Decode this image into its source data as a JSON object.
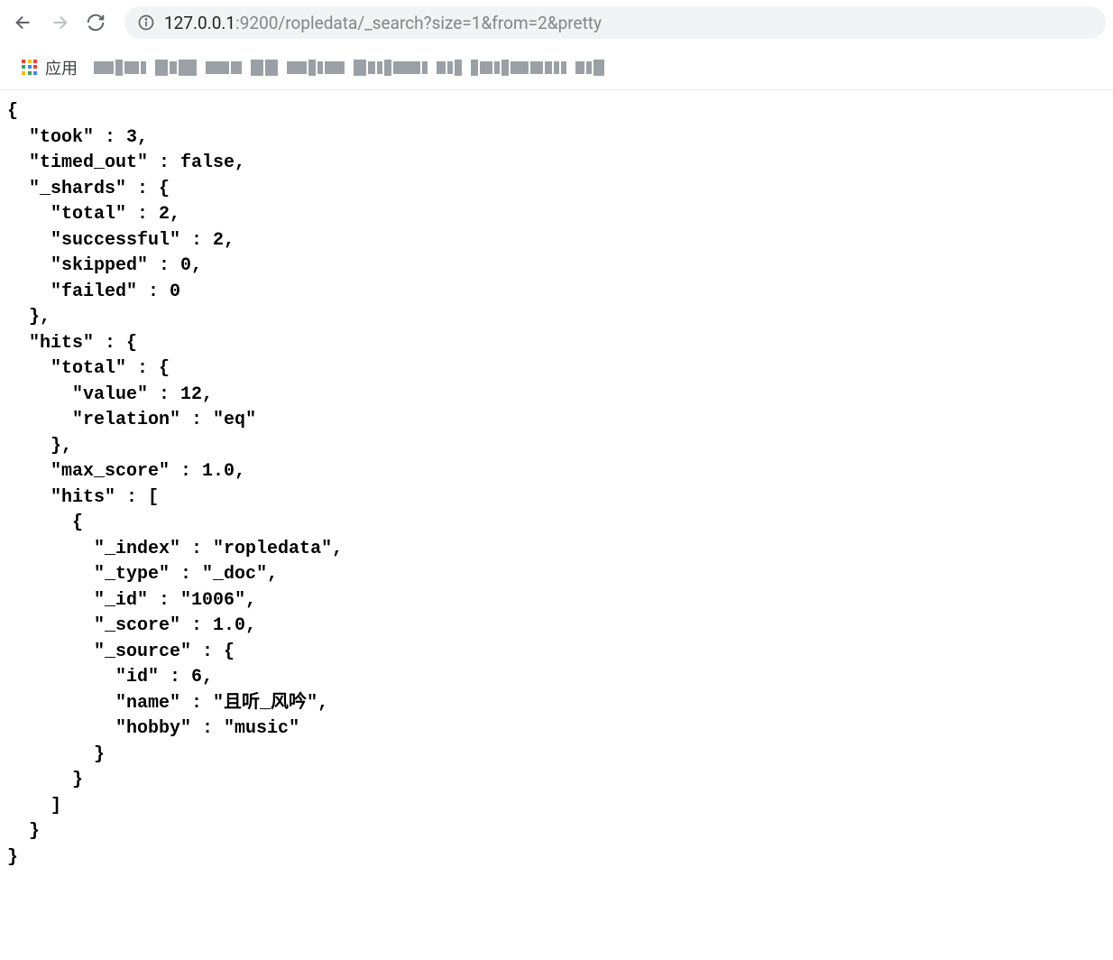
{
  "toolbar": {
    "url_host": "127.0.0.1",
    "url_port_path": ":9200/ropledata/_search?size=1&from=2&pretty"
  },
  "bookmarks": {
    "apps_label": "应用"
  },
  "response": {
    "took": 3,
    "timed_out": "false",
    "_shards": {
      "total": 2,
      "successful": 2,
      "skipped": 0,
      "failed": 0
    },
    "hits": {
      "total": {
        "value": 12,
        "relation": "eq"
      },
      "max_score": "1.0",
      "hit0": {
        "_index": "ropledata",
        "_type": "_doc",
        "_id": "1006",
        "_score": "1.0",
        "_source": {
          "id": 6,
          "name": "且听_风吟",
          "hobby": "music"
        }
      }
    }
  }
}
